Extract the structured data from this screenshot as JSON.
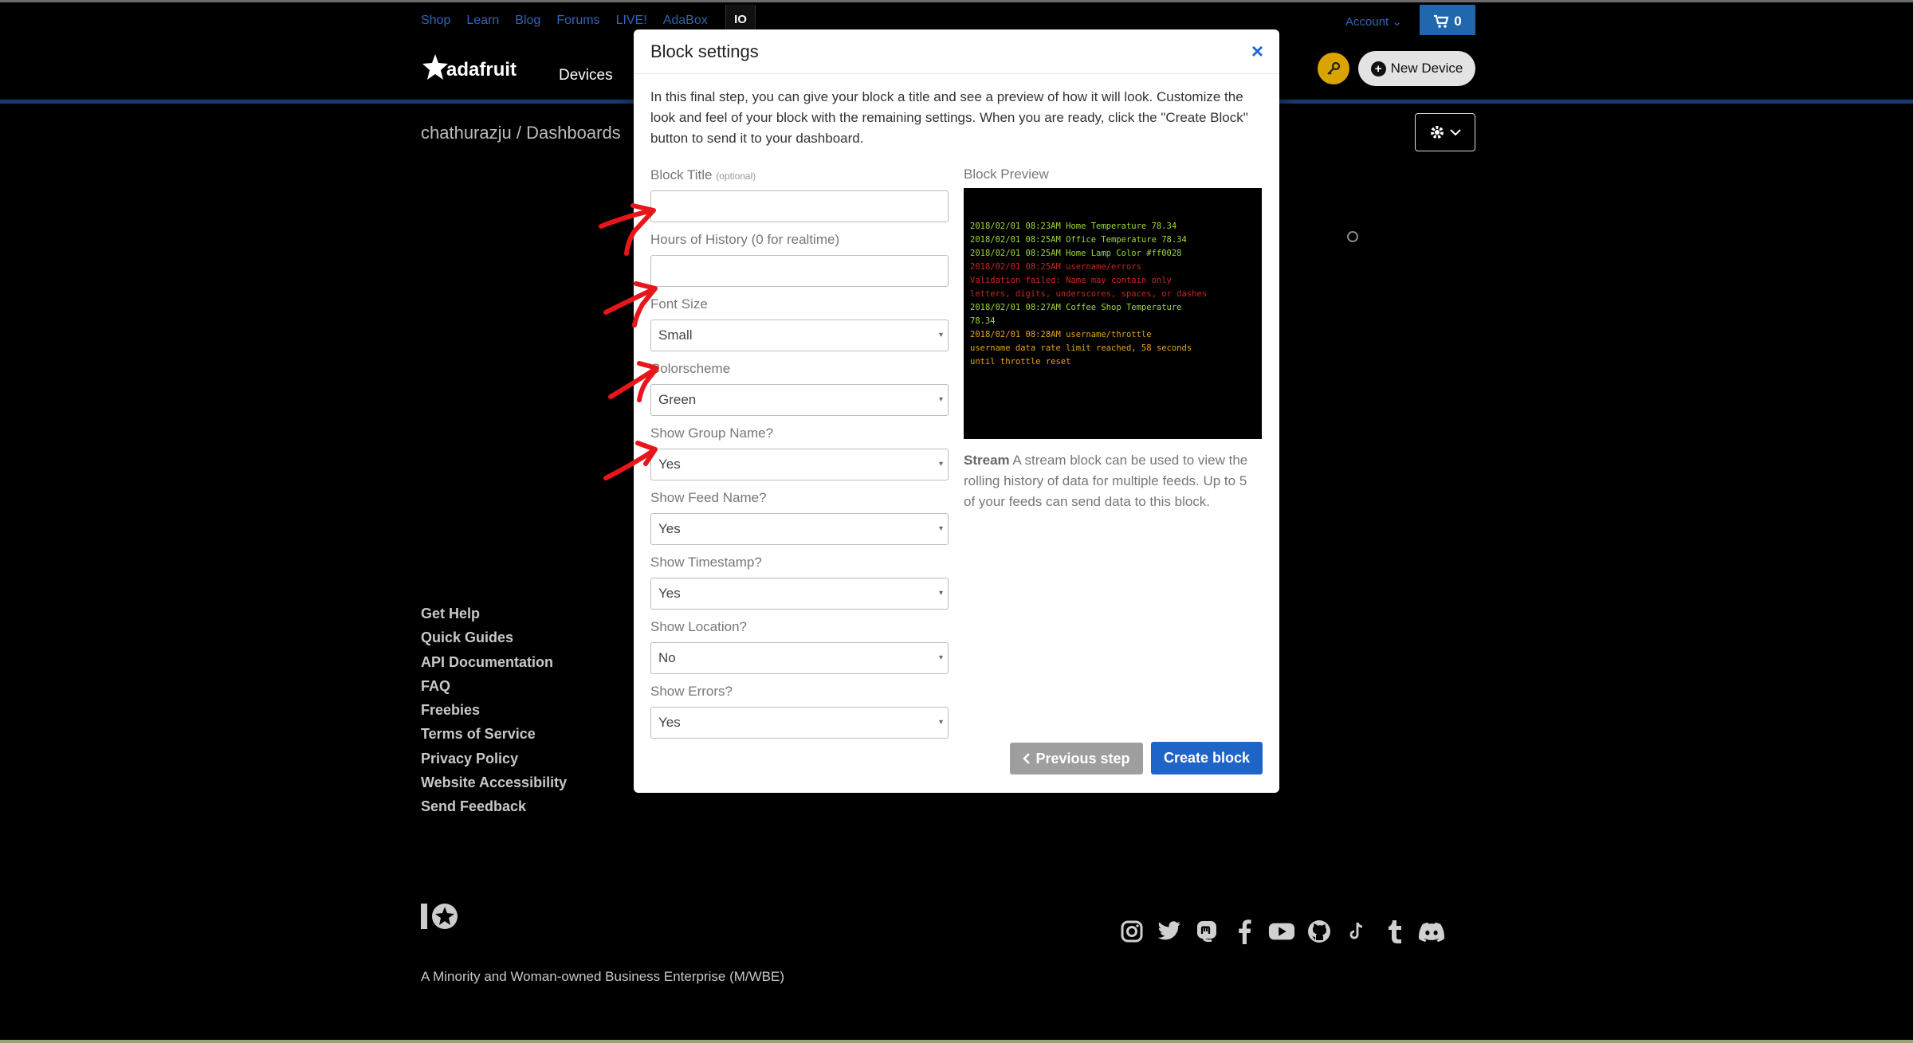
{
  "topbar": {
    "links": [
      "Shop",
      "Learn",
      "Blog",
      "Forums",
      "LIVE!",
      "AdaBox"
    ],
    "io_label": "IO",
    "account_label": "Account",
    "cart_count": "0"
  },
  "navbar": {
    "brand": "adafruit",
    "devices_label": "Devices",
    "new_device_label": "New Device"
  },
  "breadcrumb": "chathurazju / Dashboards",
  "modal": {
    "title": "Block settings",
    "close_label": "×",
    "intro": "In this final step, you can give your block a title and see a preview of how it will look. Customize the look and feel of your block with the remaining settings. When you are ready, click the \"Create Block\" button to send it to your dashboard.",
    "fields": {
      "block_title_label": "Block Title",
      "block_title_optional": "(optional)",
      "block_title_value": "",
      "history_label": "Hours of History (0 for realtime)",
      "history_value": "",
      "font_size_label": "Font Size",
      "font_size_value": "Small",
      "colorscheme_label": "Colorscheme",
      "colorscheme_value": "Green",
      "show_group_label": "Show Group Name?",
      "show_group_value": "Yes",
      "show_feed_label": "Show Feed Name?",
      "show_feed_value": "Yes",
      "show_timestamp_label": "Show Timestamp?",
      "show_timestamp_value": "Yes",
      "show_location_label": "Show Location?",
      "show_location_value": "No",
      "show_errors_label": "Show Errors?",
      "show_errors_value": "Yes"
    },
    "preview_label": "Block Preview",
    "preview_lines": [
      {
        "text": "2018/02/01 08:23AM  Home  Temperature  78.34",
        "color": "g"
      },
      {
        "text": "2018/02/01 08:25AM  Office  Temperature  78.34",
        "color": "g"
      },
      {
        "text": "2018/02/01 08:25AM  Home  Lamp Color  #ff0028",
        "color": "g"
      },
      {
        "text": "2018/02/01 08:25AM    username/errors",
        "color": "r"
      },
      {
        "text": "Validation failed: Name may contain only",
        "color": "r"
      },
      {
        "text": "letters, digits, underscores, spaces, or dashes",
        "color": "r"
      },
      {
        "text": "2018/02/01 08:27AM  Coffee Shop  Temperature",
        "color": "g"
      },
      {
        "text": "78.34",
        "color": "g"
      },
      {
        "text": "2018/02/01 08:28AM    username/throttle",
        "color": "o"
      },
      {
        "text": "username data rate limit reached, 58 seconds",
        "color": "o"
      },
      {
        "text": "until throttle reset",
        "color": "o"
      }
    ],
    "desc_bold": "Stream",
    "desc_text": " A stream block can be used to view the rolling history of data for multiple feeds. Up to 5 of your feeds can send data to this block.",
    "prev_button": "Previous step",
    "create_button": "Create block"
  },
  "footer": {
    "links": [
      "Get Help",
      "Quick Guides",
      "API Documentation",
      "FAQ",
      "Freebies",
      "Terms of Service",
      "Privacy Policy",
      "Website Accessibility",
      "Send Feedback"
    ],
    "tagline": "A Minority and Woman-owned Business Enterprise (M/WBE)",
    "socials": [
      "instagram-icon",
      "twitter-icon",
      "mastodon-icon",
      "facebook-icon",
      "youtube-icon",
      "github-icon",
      "tiktok-icon",
      "tumblr-icon",
      "discord-icon"
    ]
  },
  "colors": {
    "accent_blue": "#1f64c7",
    "annotation_red": "#e8161b",
    "preview_green": "#9fd83c",
    "preview_red": "#c9261f",
    "preview_orange": "#e6a219"
  }
}
